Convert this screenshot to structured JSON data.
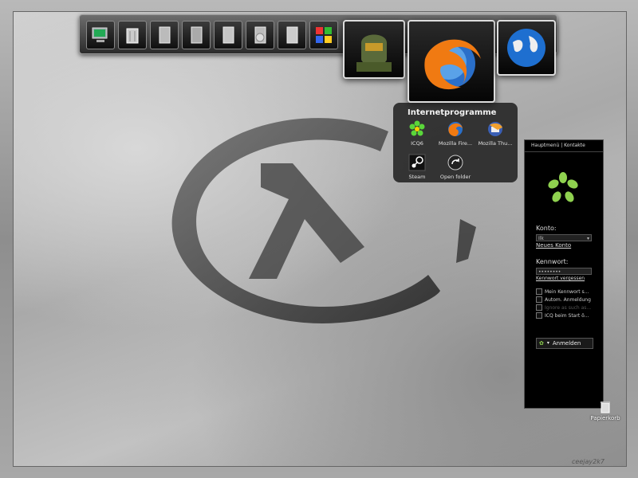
{
  "dock": {
    "items": [
      {
        "name": "my-computer-icon"
      },
      {
        "name": "recycle-bin-icon"
      },
      {
        "name": "documents-icon"
      },
      {
        "name": "files-icon"
      },
      {
        "name": "folder-icon"
      },
      {
        "name": "cd-drive-icon"
      },
      {
        "name": "blank-document-icon"
      },
      {
        "name": "windows-icon"
      },
      {
        "name": "master-chief-icon"
      },
      {
        "name": "firefox-icon"
      },
      {
        "name": "globe-icon"
      }
    ]
  },
  "popup": {
    "title": "Internetprogramme",
    "items": [
      {
        "label": "ICQ6"
      },
      {
        "label": "Mozilla Fire..."
      },
      {
        "label": "Mozilla Thu..."
      },
      {
        "label": "Steam"
      },
      {
        "label": "Open folder"
      }
    ]
  },
  "icq": {
    "menu": "Hauptmenü | Kontakte",
    "account_label": "Konto:",
    "account_value": "Ilk",
    "new_account": "Neues Konto",
    "password_label": "Kennwort:",
    "password_value": "••••••••",
    "forgot_password": "Kennwort vergessen",
    "options": [
      {
        "label": "Mein Kennwort s...",
        "enabled": true
      },
      {
        "label": "Autom. Anmeldung",
        "enabled": true
      },
      {
        "label": "Ignore as such as...",
        "enabled": false
      },
      {
        "label": "ICQ beim Start ö...",
        "enabled": true
      }
    ],
    "login_button": "Anmelden"
  },
  "desktop_icon": {
    "label": "Papierkorb"
  },
  "signature": "ceejay2k7"
}
